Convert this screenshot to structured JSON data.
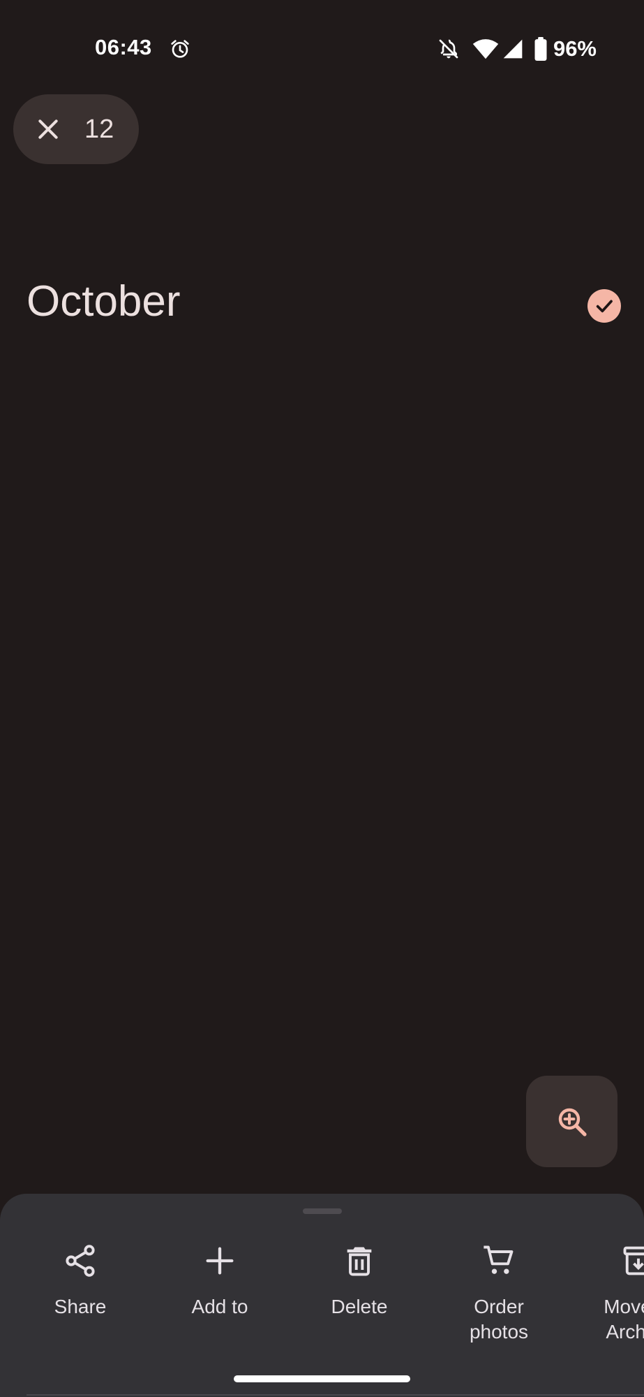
{
  "status_bar": {
    "time": "06:43",
    "battery_percent": "96%",
    "icons": [
      "alarm-icon",
      "notifications-off-icon",
      "wifi-icon",
      "signal-icon",
      "battery-icon"
    ]
  },
  "selection": {
    "close_icon": "close-icon",
    "count": "12"
  },
  "section": {
    "month": "October",
    "selected": true
  },
  "zoom_button": {
    "icon": "zoom-in-icon"
  },
  "bottom_sheet": {
    "actions": [
      {
        "label": "Share",
        "icon": "share-icon"
      },
      {
        "label": "Add to",
        "icon": "plus-icon"
      },
      {
        "label": "Delete",
        "icon": "trash-icon"
      },
      {
        "label": "Order\nphotos",
        "icon": "cart-icon"
      },
      {
        "label": "Move to\nArchive",
        "icon": "archive-icon"
      }
    ]
  },
  "colors": {
    "background": "#201a1a",
    "chip": "#3a3130",
    "accent": "#f5b6a6",
    "sheet": "#333236"
  }
}
